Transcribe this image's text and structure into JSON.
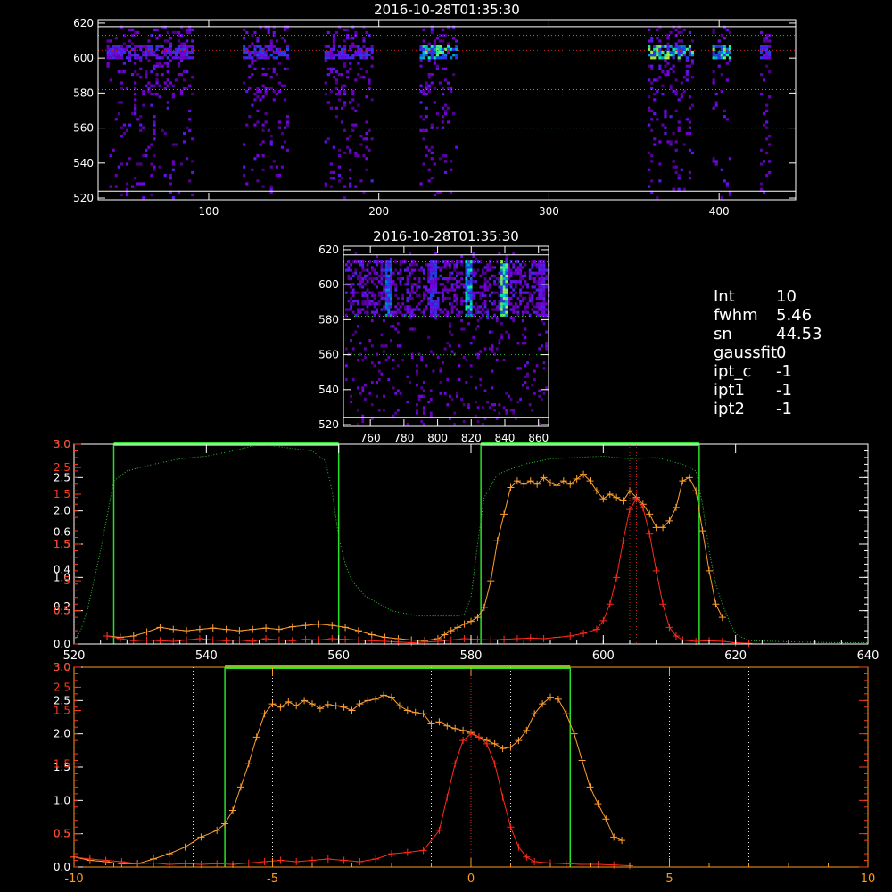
{
  "colors": {
    "background": "#000000",
    "axis": "#ffffff",
    "axis_red": "#ff3a1a",
    "axis_orange": "#ff9a1a",
    "orange_series": "#ffa030",
    "red_series": "#ff2a1a",
    "green_band": "#28e028",
    "dotted_white": "#e8e8e8",
    "dotted_green": "#30c030",
    "dotted_red": "#d02020"
  },
  "info_panel": {
    "lines": [
      {
        "label": "Int",
        "value": "10"
      },
      {
        "label": "fwhm",
        "value": "5.46"
      },
      {
        "label": "sn",
        "value": "44.53"
      },
      {
        "label": "gaussfit",
        "value": "0"
      },
      {
        "label": "ipt_c",
        "value": "-1"
      },
      {
        "label": "ipt1",
        "value": "-1"
      },
      {
        "label": "ipt2",
        "value": "-1"
      }
    ]
  },
  "chart_data": [
    {
      "type": "heatmap",
      "title": "2016-10-28T01:35:30",
      "colormap": "black-purple-blue-cyan-yellow",
      "xlim": [
        35,
        445
      ],
      "ylim": [
        519,
        622
      ],
      "x_ticks": [
        100,
        200,
        300,
        400
      ],
      "y_ticks": [
        520,
        540,
        560,
        580,
        600,
        620
      ],
      "hlines_white": [
        524,
        618
      ],
      "hlines_green": [
        582,
        613,
        560
      ],
      "hlines_red": [
        604.5
      ],
      "bright_bands": [
        {
          "x0": 40,
          "x1": 90,
          "intensity": 0.45
        },
        {
          "x0": 120,
          "x1": 147,
          "intensity": 0.5
        },
        {
          "x0": 168,
          "x1": 196,
          "intensity": 0.45
        },
        {
          "x0": 224,
          "x1": 245,
          "intensity": 0.85
        },
        {
          "x0": 358,
          "x1": 385,
          "intensity": 0.9
        },
        {
          "x0": 396,
          "x1": 406,
          "intensity": 0.85
        },
        {
          "x0": 424,
          "x1": 429,
          "intensity": 0.5
        }
      ],
      "band_center_y": 604
    },
    {
      "type": "heatmap",
      "title": "2016-10-28T01:35:30",
      "colormap": "black-purple-blue-cyan-yellow",
      "xlim": [
        744,
        866
      ],
      "ylim": [
        519,
        622
      ],
      "x_ticks": [
        760,
        780,
        800,
        820,
        840,
        860
      ],
      "y_ticks": [
        520,
        540,
        560,
        580,
        600,
        620
      ],
      "hlines_white": [
        524,
        617
      ],
      "hlines_green": [
        582,
        613,
        560
      ],
      "bright_columns": [
        {
          "x": 770,
          "intensity": 0.6
        },
        {
          "x": 797,
          "intensity": 0.5
        },
        {
          "x": 818,
          "intensity": 0.8
        },
        {
          "x": 839,
          "intensity": 0.95
        },
        {
          "x": 861,
          "intensity": 0.4
        }
      ]
    },
    {
      "type": "line",
      "title": "",
      "xlabel": "",
      "ylabel": "",
      "xlim": [
        520,
        640
      ],
      "x_ticks": [
        520,
        540,
        560,
        580,
        600,
        620,
        640
      ],
      "ylim": [
        0,
        3.0
      ],
      "left_ticks_white": [
        0.0,
        0.5,
        1.0,
        1.5,
        2.0,
        2.5,
        3.0
      ],
      "left_ticks_red_labels": [
        "0.5",
        "5",
        "1.5",
        "1.5",
        "2.5",
        "3.0"
      ],
      "left_ticks_red_values": [
        0.5,
        0.95,
        1.5,
        2.25,
        2.65,
        3.0
      ],
      "left_ticks_white_alt": [
        "0.2",
        "0.4",
        "0.6"
      ],
      "left_ticks_white_alt_values": [
        0.56,
        1.12,
        1.68
      ],
      "green_bands": [
        {
          "x0": 526,
          "x1": 560
        },
        {
          "x0": 581.5,
          "x1": 614.5
        }
      ],
      "vline_red_dotted": [
        604,
        605
      ],
      "series": [
        {
          "name": "",
          "style": "dotted-green",
          "x": [
            520,
            521,
            522,
            524,
            526,
            528,
            532,
            536,
            540,
            544,
            548,
            552,
            556,
            558,
            559,
            560,
            561,
            562,
            564,
            568,
            572,
            576,
            578,
            579,
            580,
            581,
            582,
            584,
            588,
            592,
            596,
            600,
            604,
            608,
            612,
            614,
            615,
            616,
            617,
            618,
            619,
            620,
            622,
            626,
            630,
            636,
            640
          ],
          "y": [
            0.05,
            0.2,
            0.5,
            1.4,
            2.45,
            2.6,
            2.7,
            2.78,
            2.82,
            2.9,
            3.0,
            2.95,
            2.9,
            2.75,
            2.3,
            1.6,
            1.2,
            0.95,
            0.72,
            0.5,
            0.42,
            0.42,
            0.42,
            0.45,
            0.7,
            1.5,
            2.2,
            2.55,
            2.7,
            2.78,
            2.8,
            2.82,
            2.78,
            2.8,
            2.7,
            2.6,
            2.1,
            1.4,
            0.9,
            0.6,
            0.35,
            0.15,
            0.05,
            0.04,
            0.03,
            0.02,
            0.02
          ]
        },
        {
          "name": "",
          "style": "orange-plus",
          "x": [
            525,
            527,
            529,
            531,
            533,
            535,
            537,
            539,
            541,
            543,
            545,
            547,
            549,
            551,
            553,
            555,
            557,
            559,
            561,
            563,
            565,
            567,
            569,
            571,
            573,
            575,
            576,
            577,
            578,
            579,
            580,
            581,
            582,
            583,
            584,
            585,
            586,
            587,
            588,
            589,
            590,
            591,
            592,
            593,
            594,
            595,
            596,
            597,
            598,
            599,
            600,
            601,
            602,
            603,
            604,
            605,
            606,
            607,
            608,
            609,
            610,
            611,
            612,
            613,
            614,
            615,
            616,
            617,
            618
          ],
          "y": [
            0.12,
            0.1,
            0.12,
            0.18,
            0.25,
            0.22,
            0.2,
            0.22,
            0.24,
            0.22,
            0.2,
            0.22,
            0.24,
            0.22,
            0.26,
            0.28,
            0.3,
            0.28,
            0.25,
            0.2,
            0.14,
            0.1,
            0.08,
            0.06,
            0.05,
            0.08,
            0.14,
            0.2,
            0.25,
            0.3,
            0.34,
            0.4,
            0.55,
            0.95,
            1.55,
            1.95,
            2.35,
            2.45,
            2.4,
            2.45,
            2.4,
            2.5,
            2.42,
            2.38,
            2.45,
            2.4,
            2.48,
            2.55,
            2.45,
            2.3,
            2.18,
            2.25,
            2.2,
            2.15,
            2.3,
            2.2,
            2.1,
            1.95,
            1.75,
            1.75,
            1.85,
            2.05,
            2.45,
            2.5,
            2.3,
            1.7,
            1.1,
            0.6,
            0.4
          ]
        },
        {
          "name": "",
          "style": "red-plus",
          "x": [
            525,
            527,
            529,
            531,
            533,
            535,
            537,
            539,
            541,
            543,
            545,
            547,
            549,
            551,
            553,
            555,
            557,
            559,
            561,
            563,
            565,
            567,
            569,
            571,
            573,
            575,
            577,
            579,
            581,
            583,
            585,
            587,
            589,
            591,
            593,
            595,
            597,
            599,
            600,
            601,
            602,
            603,
            604,
            605,
            606,
            607,
            608,
            609,
            610,
            611,
            612,
            614,
            616,
            618,
            620,
            622
          ],
          "y": [
            0.12,
            0.08,
            0.05,
            0.06,
            0.05,
            0.04,
            0.06,
            0.08,
            0.06,
            0.05,
            0.06,
            0.04,
            0.08,
            0.06,
            0.05,
            0.07,
            0.06,
            0.08,
            0.07,
            0.06,
            0.05,
            0.04,
            0.03,
            0.02,
            0.03,
            0.04,
            0.06,
            0.08,
            0.07,
            0.06,
            0.07,
            0.08,
            0.09,
            0.08,
            0.1,
            0.12,
            0.16,
            0.22,
            0.35,
            0.6,
            1.0,
            1.55,
            2.02,
            2.18,
            2.05,
            1.65,
            1.1,
            0.6,
            0.25,
            0.12,
            0.06,
            0.04,
            0.05,
            0.04,
            0.02,
            0.01
          ]
        }
      ]
    },
    {
      "type": "line",
      "title": "",
      "xlabel": "",
      "ylabel": "",
      "xlim": [
        -10,
        10
      ],
      "x_ticks": [
        -10,
        -5,
        0,
        5,
        10
      ],
      "ylim": [
        0,
        3.0
      ],
      "left_ticks_white": [
        0.0,
        0.5,
        1.0,
        1.5,
        2.0,
        2.5,
        3.0
      ],
      "left_ticks_red_labels": [
        "0.5",
        "1.5",
        "1.5",
        "2.5",
        "3.0"
      ],
      "left_ticks_red_values": [
        0.5,
        1.55,
        2.35,
        2.7,
        3.0
      ],
      "green_band": {
        "x0": -6.2,
        "x1": 2.5
      },
      "vlines_white_dotted": [
        -7,
        -5,
        -1,
        1,
        5,
        7
      ],
      "vline_red_dotted": [
        0
      ],
      "series": [
        {
          "name": "",
          "style": "orange-plus",
          "x": [
            -10,
            -9.6,
            -9.2,
            -8.8,
            -8.4,
            -8.0,
            -7.6,
            -7.2,
            -6.8,
            -6.4,
            -6.2,
            -6.0,
            -5.8,
            -5.6,
            -5.4,
            -5.2,
            -5.0,
            -4.8,
            -4.6,
            -4.4,
            -4.2,
            -4.0,
            -3.8,
            -3.6,
            -3.4,
            -3.2,
            -3.0,
            -2.8,
            -2.6,
            -2.4,
            -2.2,
            -2.0,
            -1.8,
            -1.6,
            -1.4,
            -1.2,
            -1.0,
            -0.8,
            -0.6,
            -0.4,
            -0.2,
            0.0,
            0.2,
            0.4,
            0.6,
            0.8,
            1.0,
            1.2,
            1.4,
            1.6,
            1.8,
            2.0,
            2.2,
            2.4,
            2.6,
            2.8,
            3.0,
            3.2,
            3.4,
            3.6,
            3.8
          ],
          "y": [
            0.15,
            0.1,
            0.08,
            0.05,
            0.05,
            0.12,
            0.2,
            0.3,
            0.45,
            0.55,
            0.65,
            0.85,
            1.2,
            1.55,
            1.95,
            2.3,
            2.45,
            2.4,
            2.48,
            2.42,
            2.5,
            2.45,
            2.38,
            2.44,
            2.42,
            2.4,
            2.35,
            2.45,
            2.5,
            2.52,
            2.58,
            2.55,
            2.42,
            2.35,
            2.32,
            2.3,
            2.15,
            2.18,
            2.12,
            2.08,
            2.05,
            2.02,
            1.95,
            1.9,
            1.85,
            1.78,
            1.8,
            1.9,
            2.05,
            2.3,
            2.45,
            2.55,
            2.52,
            2.3,
            2.0,
            1.6,
            1.2,
            0.95,
            0.72,
            0.45,
            0.4
          ]
        },
        {
          "name": "",
          "style": "red-plus",
          "x": [
            -10,
            -9.6,
            -9.2,
            -8.8,
            -8.4,
            -8.0,
            -7.6,
            -7.2,
            -6.8,
            -6.4,
            -6.0,
            -5.6,
            -5.2,
            -4.8,
            -4.4,
            -4.0,
            -3.6,
            -3.2,
            -2.8,
            -2.4,
            -2.0,
            -1.6,
            -1.2,
            -0.8,
            -0.6,
            -0.4,
            -0.2,
            0.0,
            0.2,
            0.4,
            0.6,
            0.8,
            1.0,
            1.2,
            1.4,
            1.6,
            2.0,
            2.4,
            2.8,
            3.2,
            3.6,
            4.0
          ],
          "y": [
            0.15,
            0.12,
            0.1,
            0.08,
            0.05,
            0.06,
            0.04,
            0.05,
            0.04,
            0.05,
            0.04,
            0.06,
            0.08,
            0.1,
            0.08,
            0.1,
            0.12,
            0.1,
            0.08,
            0.12,
            0.2,
            0.22,
            0.25,
            0.55,
            1.05,
            1.55,
            1.9,
            2.0,
            1.95,
            1.85,
            1.55,
            1.05,
            0.6,
            0.3,
            0.15,
            0.08,
            0.06,
            0.05,
            0.04,
            0.04,
            0.03,
            0.02
          ]
        }
      ]
    }
  ]
}
